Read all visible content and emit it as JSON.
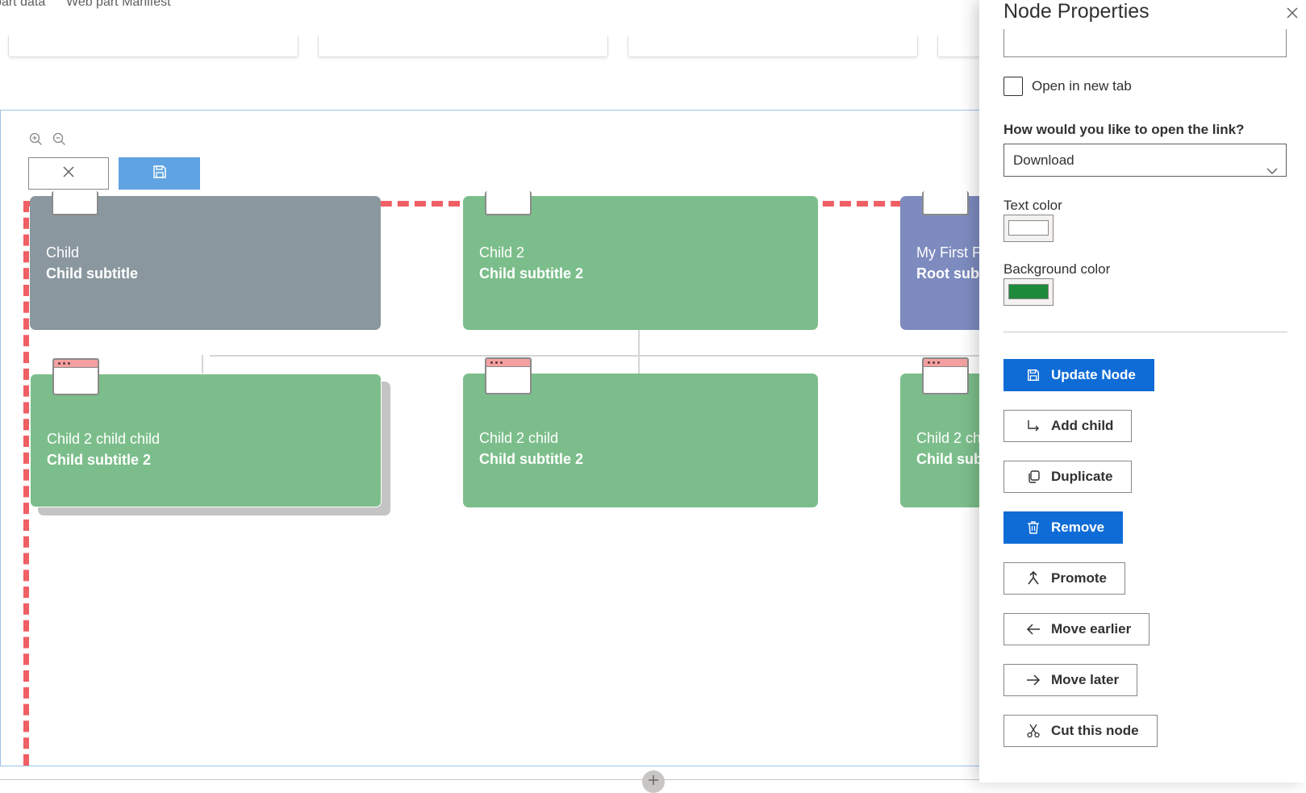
{
  "top_tabs": [
    "Web part data",
    "Web part Manifest"
  ],
  "canvas": {
    "zoom_in_icon": "zoom-in-icon",
    "zoom_out_icon": "zoom-out-icon",
    "cancel_icon": "close-icon",
    "save_icon": "save-icon"
  },
  "nodes": [
    {
      "title": "Child",
      "subtitle": "Child subtitle",
      "color": "#8a979f"
    },
    {
      "title": "Child 2",
      "subtitle": "Child subtitle 2",
      "color": "#7cbe8b"
    },
    {
      "title": "My First F",
      "subtitle": "Root sub",
      "color": "#7d8bbf"
    },
    {
      "title": "Child 2 child child",
      "subtitle": "Child subtitle 2",
      "color": "#7cbe8b"
    },
    {
      "title": "Child 2 child",
      "subtitle": "Child subtitle 2",
      "color": "#7cbe8b"
    },
    {
      "title": "Child 2 ch",
      "subtitle": "Child sub",
      "color": "#7cbe8b"
    }
  ],
  "panel": {
    "title": "Node Properties",
    "open_new_tab_label": "Open in new tab",
    "open_link_question": "How would you like to open the link?",
    "open_link_selected": "Download",
    "text_color_label": "Text color",
    "text_color_value": "#ffffff",
    "background_color_label": "Background color",
    "background_color_value": "#1e8a3c",
    "buttons": {
      "update": "Update Node",
      "add_child": "Add child",
      "duplicate": "Duplicate",
      "remove": "Remove",
      "promote": "Promote",
      "move_earlier": "Move earlier",
      "move_later": "Move later",
      "cut": "Cut this node"
    }
  },
  "accent_color": "#0f6cd6",
  "selection_color": "#ef5f64"
}
